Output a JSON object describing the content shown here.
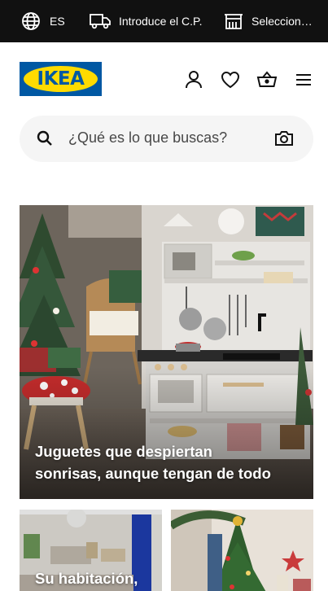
{
  "utility_bar": {
    "language_label": "ES",
    "zip_label": "Introduce el C.P.",
    "store_label": "Seleccion…"
  },
  "header": {
    "logo_text": "IKEA"
  },
  "search": {
    "placeholder": "¿Qué es lo que buscas?"
  },
  "cards": [
    {
      "title_line1": "Juguetes que despiertan",
      "title_line2": "sonrisas, aunque tengan de todo"
    },
    {
      "title": "Su habitación,"
    },
    {
      "title": ""
    }
  ],
  "colors": {
    "brand_blue": "#0058a3",
    "brand_yellow": "#ffdb00",
    "utility_bar_bg": "#111111",
    "search_bg": "#f5f5f5"
  }
}
